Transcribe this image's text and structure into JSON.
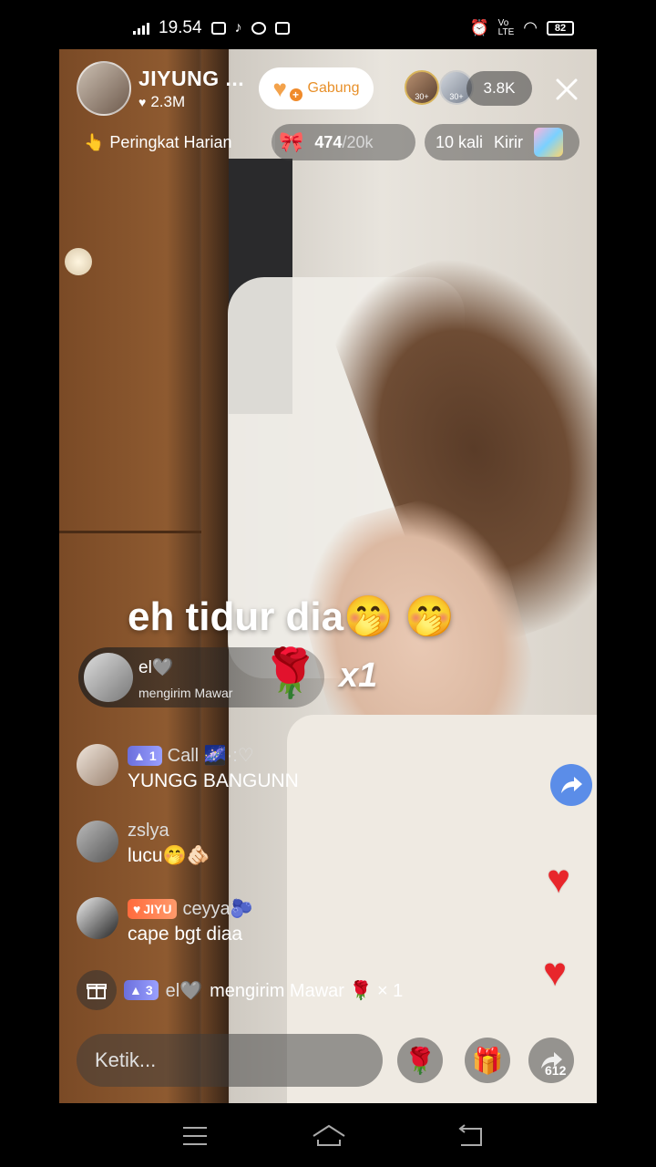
{
  "status_bar": {
    "time": "19.54",
    "battery": "82"
  },
  "host": {
    "name": "JIYUNG ...",
    "likes": "2.3M",
    "join_label": "Gabung"
  },
  "viewers": {
    "top1_badge": "30+",
    "top2_badge": "30+",
    "count": "3.8K"
  },
  "ranking": {
    "label": "Peringkat Harian"
  },
  "goal": {
    "current": "474",
    "total": "/20k",
    "progress_fraction": 0.0237
  },
  "send_gift": {
    "times": "10 kali",
    "label": "Kirir"
  },
  "caption": "eh tidur dia🤭 🤭",
  "gift_banner": {
    "user": "el🩶",
    "action": "mengirim Mawar",
    "multiplier": "x1"
  },
  "comments": [
    {
      "badge_level": "1",
      "username": "Call 🌌·:♡",
      "text": "YUNGG BANGUNN"
    },
    {
      "username": "zslya",
      "text": "lucu🤭🫵🏻"
    },
    {
      "fan_badge": "JIYU",
      "username": "ceyya🫐",
      "text": "cape bgt diaa"
    }
  ],
  "gift_event": {
    "level": "3",
    "sender": "el🩶",
    "text": "mengirim Mawar 🌹 × 1"
  },
  "bottom_bar": {
    "input_placeholder": "Ketik...",
    "share_count": "612"
  },
  "icons": {
    "rank": "👆",
    "rose": "🌹",
    "gift": "🎁"
  }
}
